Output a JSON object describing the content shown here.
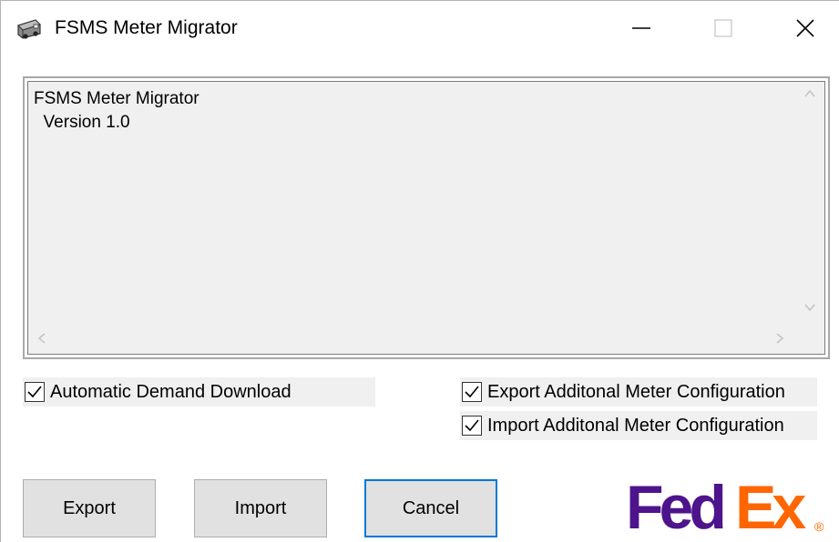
{
  "window": {
    "title": "FSMS Meter Migrator",
    "controls": [
      "minimize",
      "maximize",
      "close"
    ]
  },
  "log": {
    "lines": [
      "FSMS Meter Migrator",
      "  Version 1.0"
    ]
  },
  "options": {
    "automatic_demand_download": {
      "label": "Automatic Demand Download",
      "checked": true
    },
    "export_additional_config": {
      "label": "Export Additonal Meter Configuration",
      "checked": true
    },
    "import_additional_config": {
      "label": "Import Additonal Meter Configuration",
      "checked": true
    }
  },
  "buttons": {
    "export": "Export",
    "import": "Import",
    "cancel": "Cancel"
  },
  "logo": {
    "text_fed": "Fed",
    "text_ex": "Ex",
    "registered": "®",
    "color_fed": "#4d148c",
    "color_ex": "#ff6600"
  }
}
